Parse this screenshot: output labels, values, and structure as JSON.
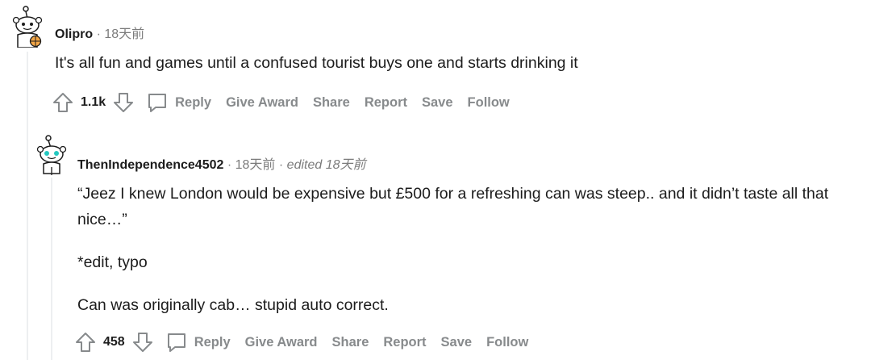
{
  "comments": [
    {
      "username": "Olipro",
      "separator": "·",
      "time": "18天前",
      "edited": "",
      "paragraphs": [
        "It's all fun and games until a confused tourist buys one and starts drinking it"
      ],
      "score": "1.1k",
      "actions": {
        "reply": "Reply",
        "give_award": "Give Award",
        "share": "Share",
        "report": "Report",
        "save": "Save",
        "follow": "Follow"
      }
    },
    {
      "username": "ThenIndependence4502",
      "separator": "·",
      "time": "18天前",
      "edited": "edited 18天前",
      "paragraphs": [
        "“Jeez I knew London would be expensive but £500 for a refreshing can was steep.. and it didn’t taste all that nice…”",
        "*edit, typo",
        "Can was originally cab… stupid auto correct."
      ],
      "score": "458",
      "actions": {
        "reply": "Reply",
        "give_award": "Give Award",
        "share": "Share",
        "report": "Report",
        "save": "Save",
        "follow": "Follow"
      }
    }
  ],
  "colors": {
    "text": "#1c1c1c",
    "meta": "#7c7c7c",
    "action": "#878a8c",
    "thread_line": "#edeff1",
    "avatar_accent": "#f2a545",
    "avatar_eyes": "#24c8c0"
  }
}
